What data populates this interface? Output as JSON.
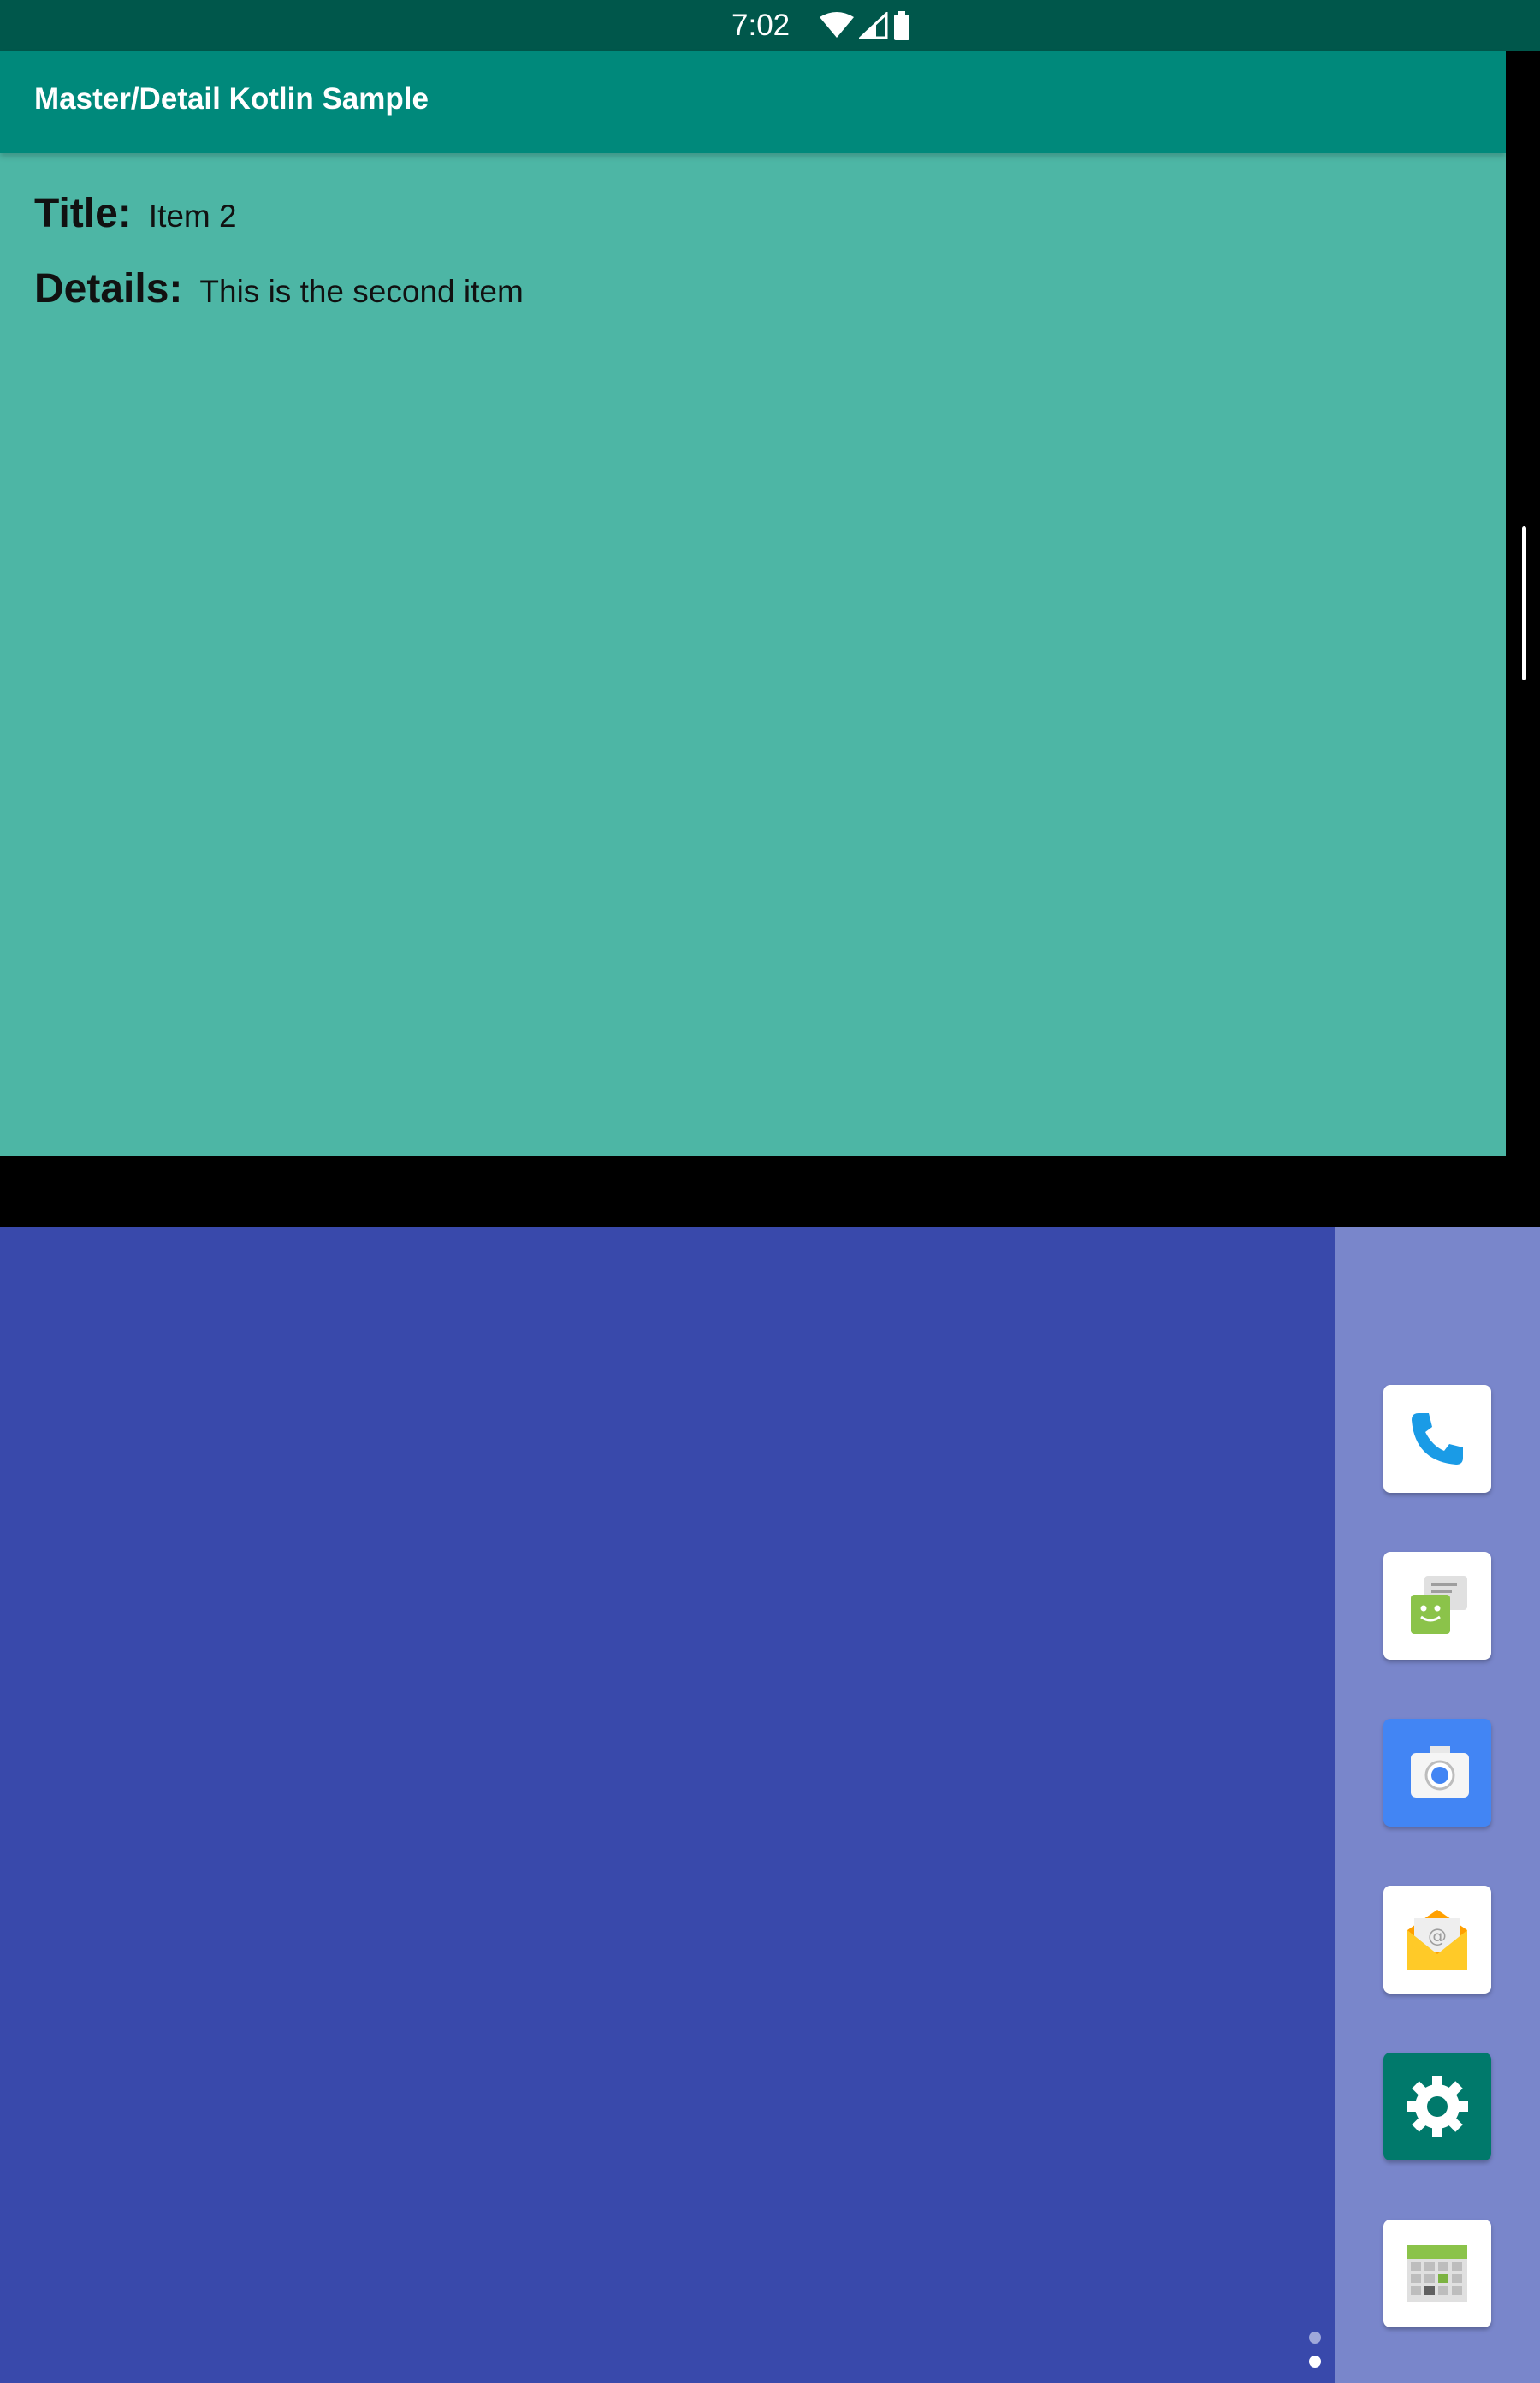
{
  "status_bar": {
    "time": "7:02"
  },
  "app": {
    "title": "Master/Detail Kotlin Sample",
    "detail": {
      "title_label": "Title:",
      "title_value": "Item 2",
      "details_label": "Details:",
      "details_value": "This is the second item"
    }
  },
  "launcher": {
    "dock_apps": [
      {
        "name": "phone-icon"
      },
      {
        "name": "messaging-icon"
      },
      {
        "name": "camera-icon"
      },
      {
        "name": "email-icon"
      },
      {
        "name": "settings-icon"
      },
      {
        "name": "calendar-icon"
      }
    ]
  },
  "colors": {
    "status_bar": "#00574b",
    "app_bar": "#00897b",
    "app_content": "#4db6a5",
    "launcher_bg": "#3949ab",
    "hotseat_bg": "#7986cb"
  }
}
